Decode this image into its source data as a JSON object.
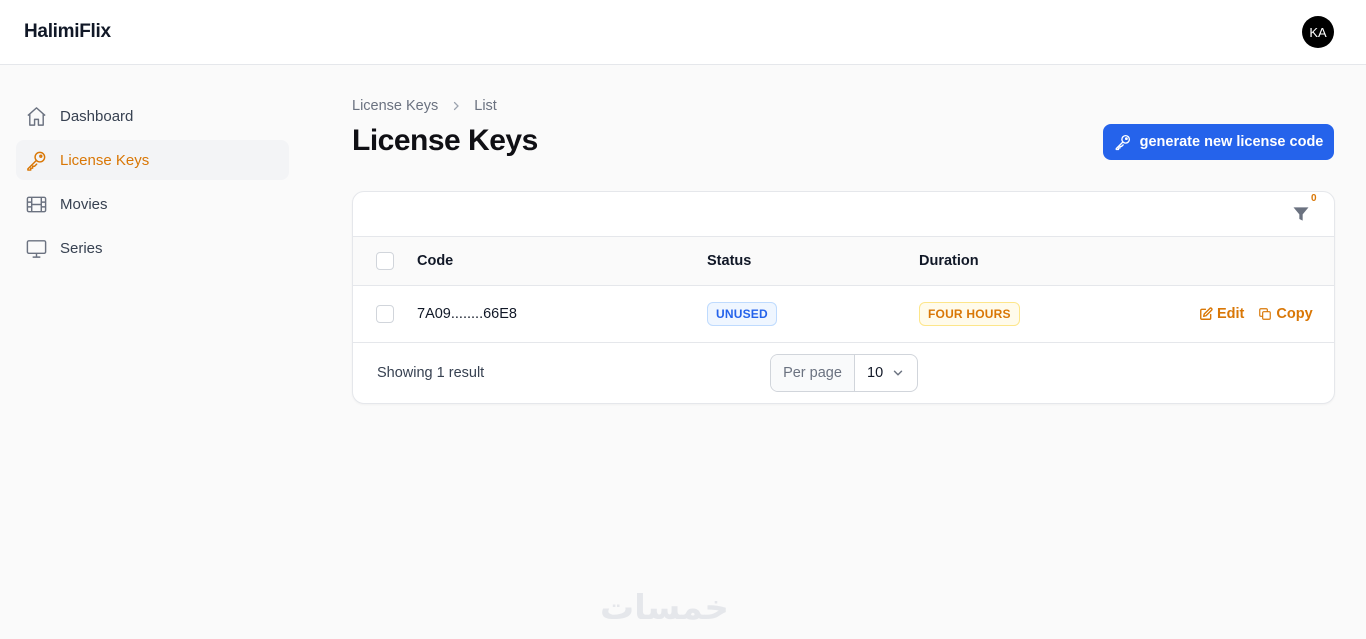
{
  "app": {
    "brand": "HalimiFlix",
    "avatar_initials": "KA"
  },
  "sidebar": {
    "items": [
      {
        "label": "Dashboard",
        "icon": "home-icon",
        "active": false
      },
      {
        "label": "License Keys",
        "icon": "key-icon",
        "active": true
      },
      {
        "label": "Movies",
        "icon": "film-icon",
        "active": false
      },
      {
        "label": "Series",
        "icon": "tv-icon",
        "active": false
      }
    ]
  },
  "breadcrumb": {
    "items": [
      "License Keys",
      "List"
    ]
  },
  "page": {
    "title": "License Keys",
    "generate_button_label": "generate new license code"
  },
  "table": {
    "filter_count": "0",
    "columns": [
      "Code",
      "Status",
      "Duration"
    ],
    "rows": [
      {
        "code": "7A09........66E8",
        "status": "UNUSED",
        "duration": "FOUR HOURS"
      }
    ],
    "actions": {
      "edit_label": "Edit",
      "copy_label": "Copy"
    }
  },
  "pagination": {
    "showing_text": "Showing 1 result",
    "per_page_label": "Per page",
    "per_page_value": "10"
  },
  "watermark": "خمسات",
  "colors": {
    "accent": "#d97706",
    "primary_button": "#2563eb",
    "unused_badge": "#2563eb"
  }
}
